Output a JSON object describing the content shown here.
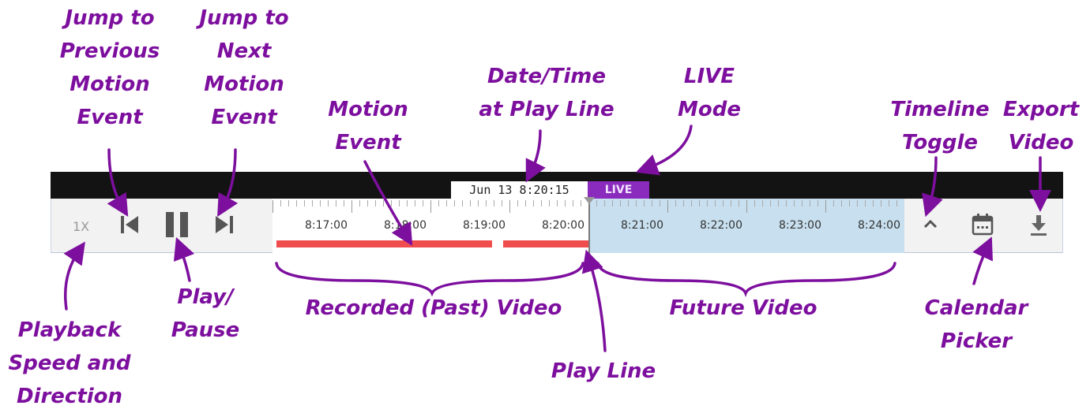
{
  "player": {
    "datetime": "Jun 13 8:20:15",
    "live_label": "LIVE",
    "speed_label": "1X",
    "timeline_labels": [
      "8:17:00",
      "8:18:00",
      "8:19:00",
      "8:20:00",
      "8:21:00",
      "8:22:00",
      "8:23:00",
      "8:24:00"
    ]
  },
  "annotations": {
    "jump_prev": [
      "Jump to",
      "Previous",
      "Motion",
      "Event"
    ],
    "jump_next": [
      "Jump to",
      "Next",
      "Motion",
      "Event"
    ],
    "motion_event": [
      "Motion",
      "Event"
    ],
    "datetime_at_playline": [
      "Date/Time",
      "at Play Line"
    ],
    "live_mode": [
      "LIVE",
      "Mode"
    ],
    "timeline_toggle": [
      "Timeline",
      "Toggle"
    ],
    "export_video": [
      "Export",
      "Video"
    ],
    "playback_speed": [
      "Playback",
      "Speed and",
      "Direction"
    ],
    "play_pause": [
      "Play/",
      "Pause"
    ],
    "recorded_video": [
      "Recorded (Past) Video"
    ],
    "future_video": [
      "Future Video"
    ],
    "play_line": [
      "Play Line"
    ],
    "calendar_picker": [
      "Calendar",
      "Picker"
    ]
  },
  "colors": {
    "annotation": "#7d0f9e",
    "live": "#8a2bbd",
    "motion": "#f04e4e",
    "future": "#c7dfee"
  }
}
